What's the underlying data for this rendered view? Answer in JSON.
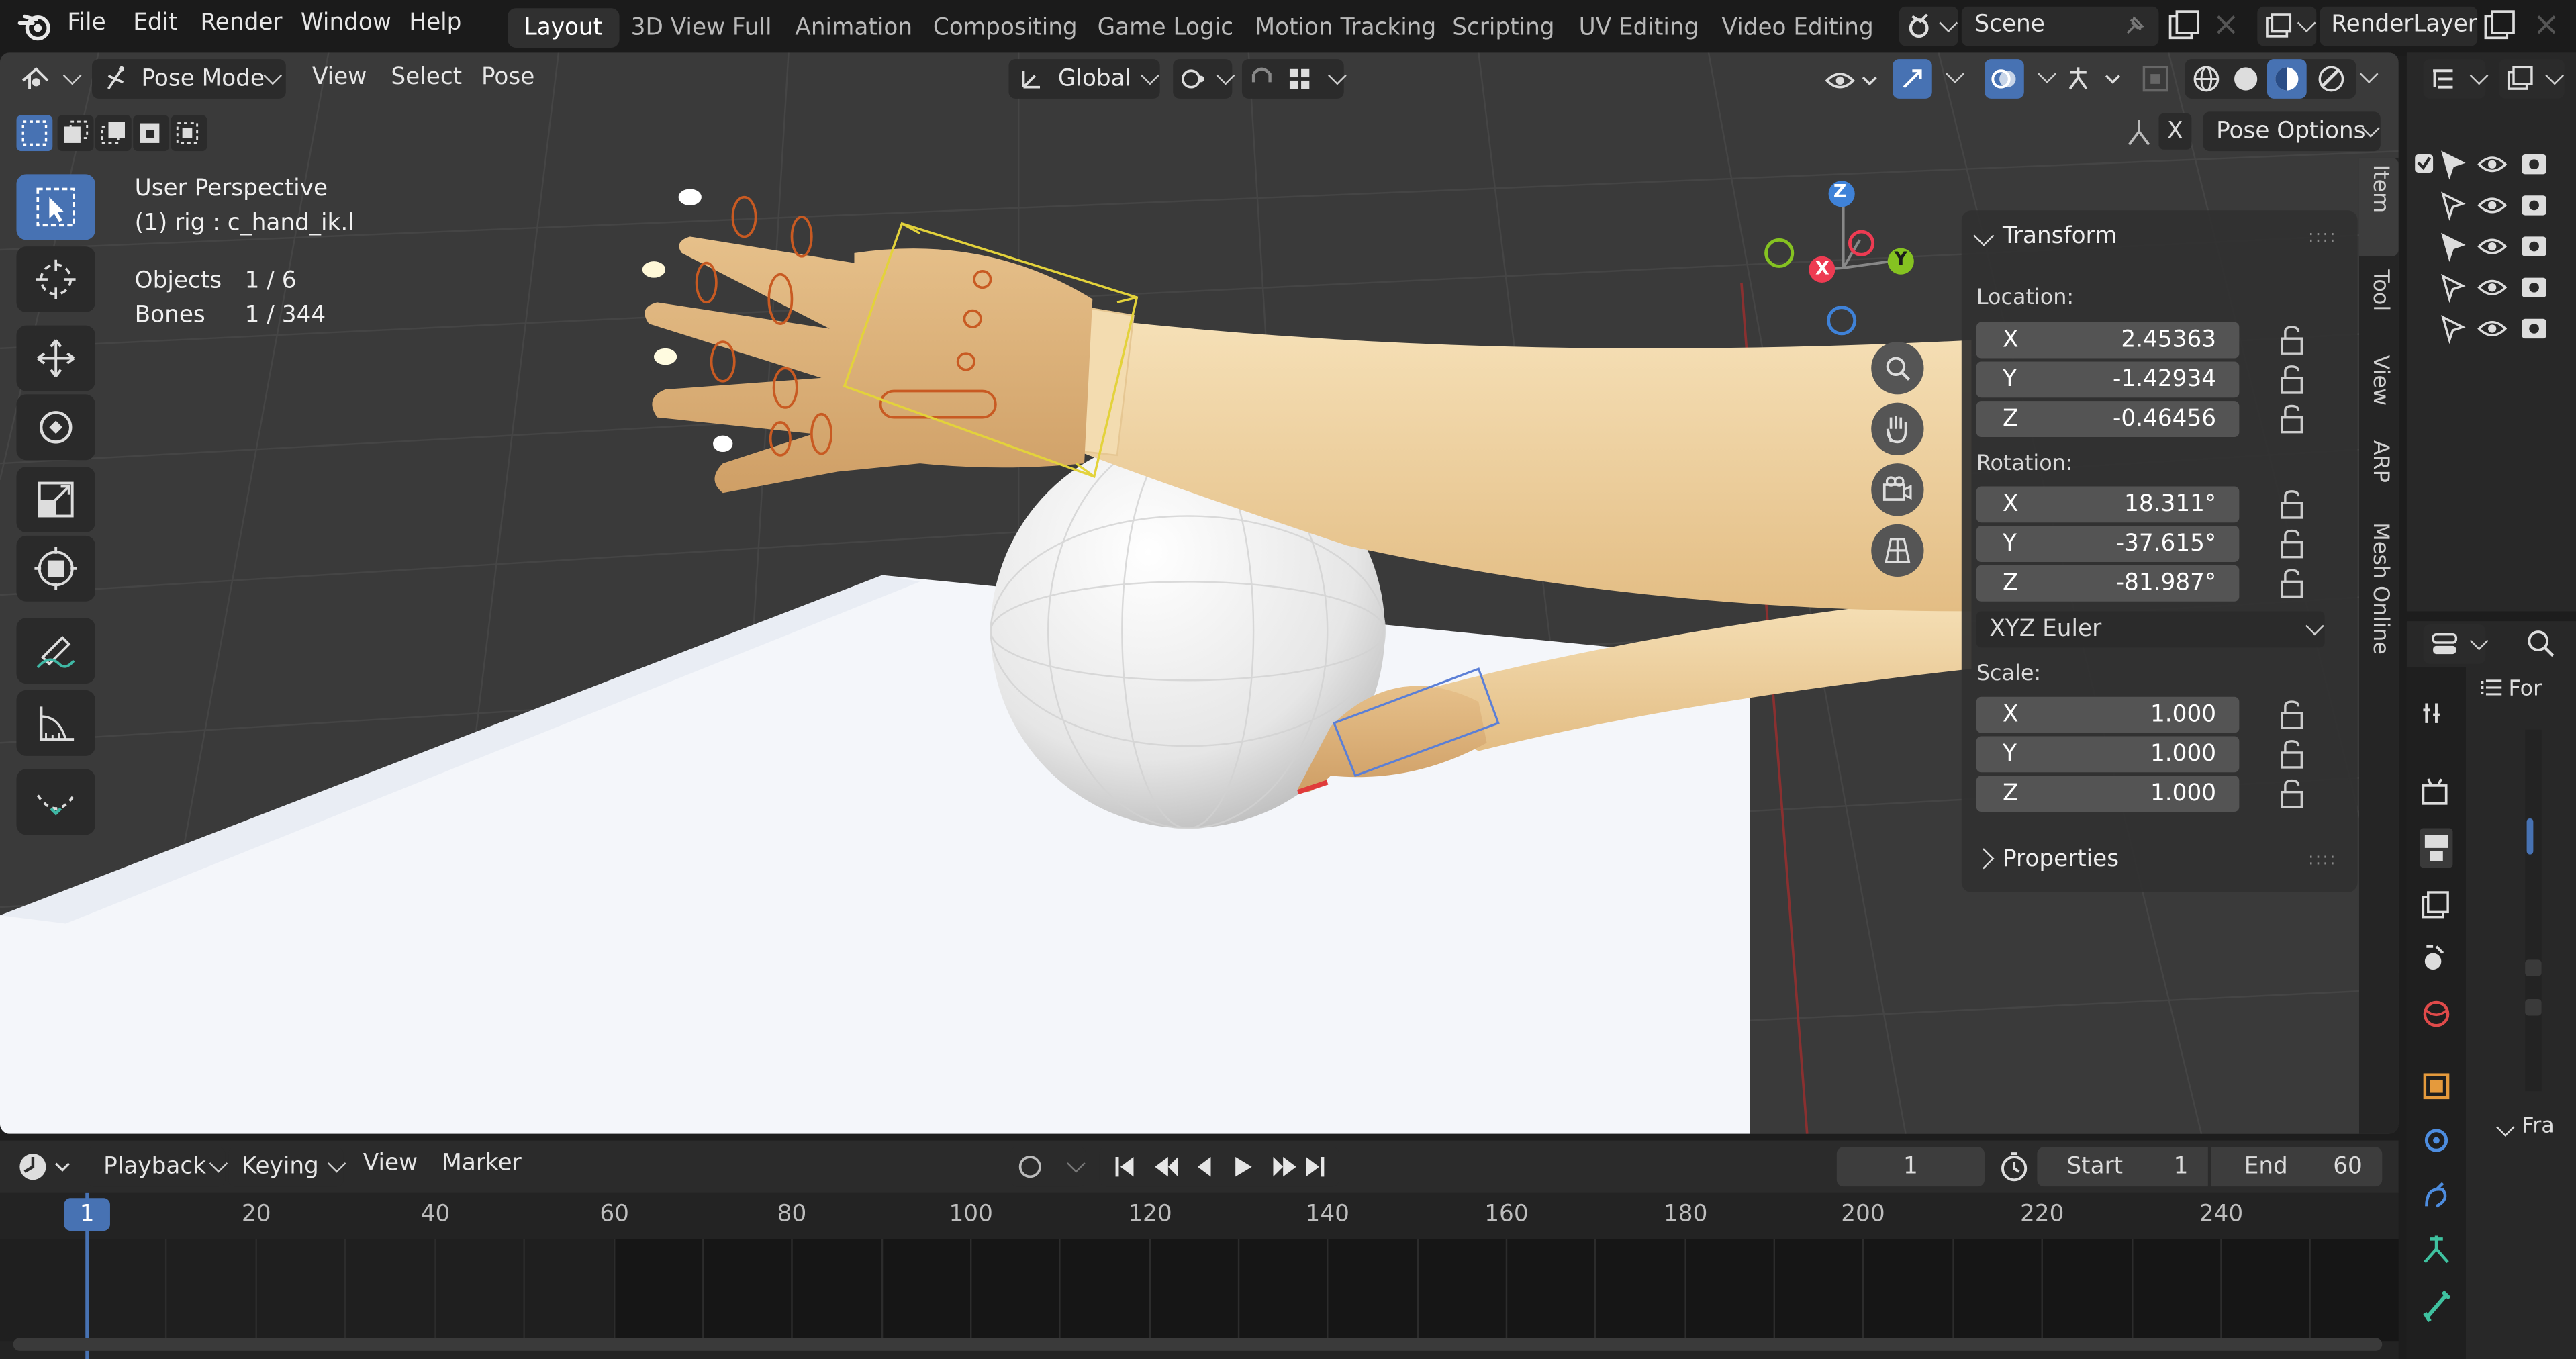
{
  "menu": {
    "file": "File",
    "edit": "Edit",
    "render": "Render",
    "window": "Window",
    "help": "Help"
  },
  "workspaces": [
    "Layout",
    "3D View Full",
    "Animation",
    "Compositing",
    "Game Logic",
    "Motion Tracking",
    "Scripting",
    "UV Editing",
    "Video Editing"
  ],
  "active_workspace": "Layout",
  "scene": {
    "label": "Scene"
  },
  "view_layer": {
    "label": "RenderLayer"
  },
  "viewport_header": {
    "mode": "Pose Mode",
    "view": "View",
    "select": "Select",
    "pose": "Pose",
    "orientation": "Global",
    "pose_options": "Pose Options"
  },
  "overlay": {
    "perspective": "User Perspective",
    "active": "(1) rig : c_hand_ik.l",
    "objects_label": "Objects",
    "objects_value": "1 / 6",
    "bones_label": "Bones",
    "bones_value": "1 / 344"
  },
  "gizmo": {
    "x": "X",
    "y": "Y",
    "z": "Z"
  },
  "transform_panel": {
    "title": "Transform",
    "location_label": "Location:",
    "location": [
      {
        "axis": "X",
        "value": "2.45363"
      },
      {
        "axis": "Y",
        "value": "-1.42934"
      },
      {
        "axis": "Z",
        "value": "-0.46456"
      }
    ],
    "rotation_label": "Rotation:",
    "rotation": [
      {
        "axis": "X",
        "value": "18.311°"
      },
      {
        "axis": "Y",
        "value": "-37.615°"
      },
      {
        "axis": "Z",
        "value": "-81.987°"
      }
    ],
    "rotation_mode": "XYZ Euler",
    "scale_label": "Scale:",
    "scale": [
      {
        "axis": "X",
        "value": "1.000"
      },
      {
        "axis": "Y",
        "value": "1.000"
      },
      {
        "axis": "Z",
        "value": "1.000"
      }
    ],
    "properties_title": "Properties"
  },
  "side_tabs": [
    "Item",
    "Tool",
    "View",
    "ARP",
    "Mesh Online"
  ],
  "timeline": {
    "playback": "Playback",
    "keying": "Keying",
    "view": "View",
    "marker": "Marker",
    "current_frame": "1",
    "start_label": "Start",
    "start_value": "1",
    "end_label": "End",
    "end_value": "60",
    "ticks": [
      "1",
      "20",
      "40",
      "60",
      "80",
      "100",
      "120",
      "140",
      "160",
      "180",
      "200",
      "220",
      "240"
    ]
  },
  "properties_panel": {
    "header_partial": "For",
    "section_partial": "Fra"
  },
  "colors": {
    "accent": "#4772b3",
    "x_axis": "#ed3b52",
    "y_axis": "#85c221",
    "z_axis": "#3f82d8",
    "bone_select": "#d4c43a",
    "bone": "#c65a2a"
  }
}
